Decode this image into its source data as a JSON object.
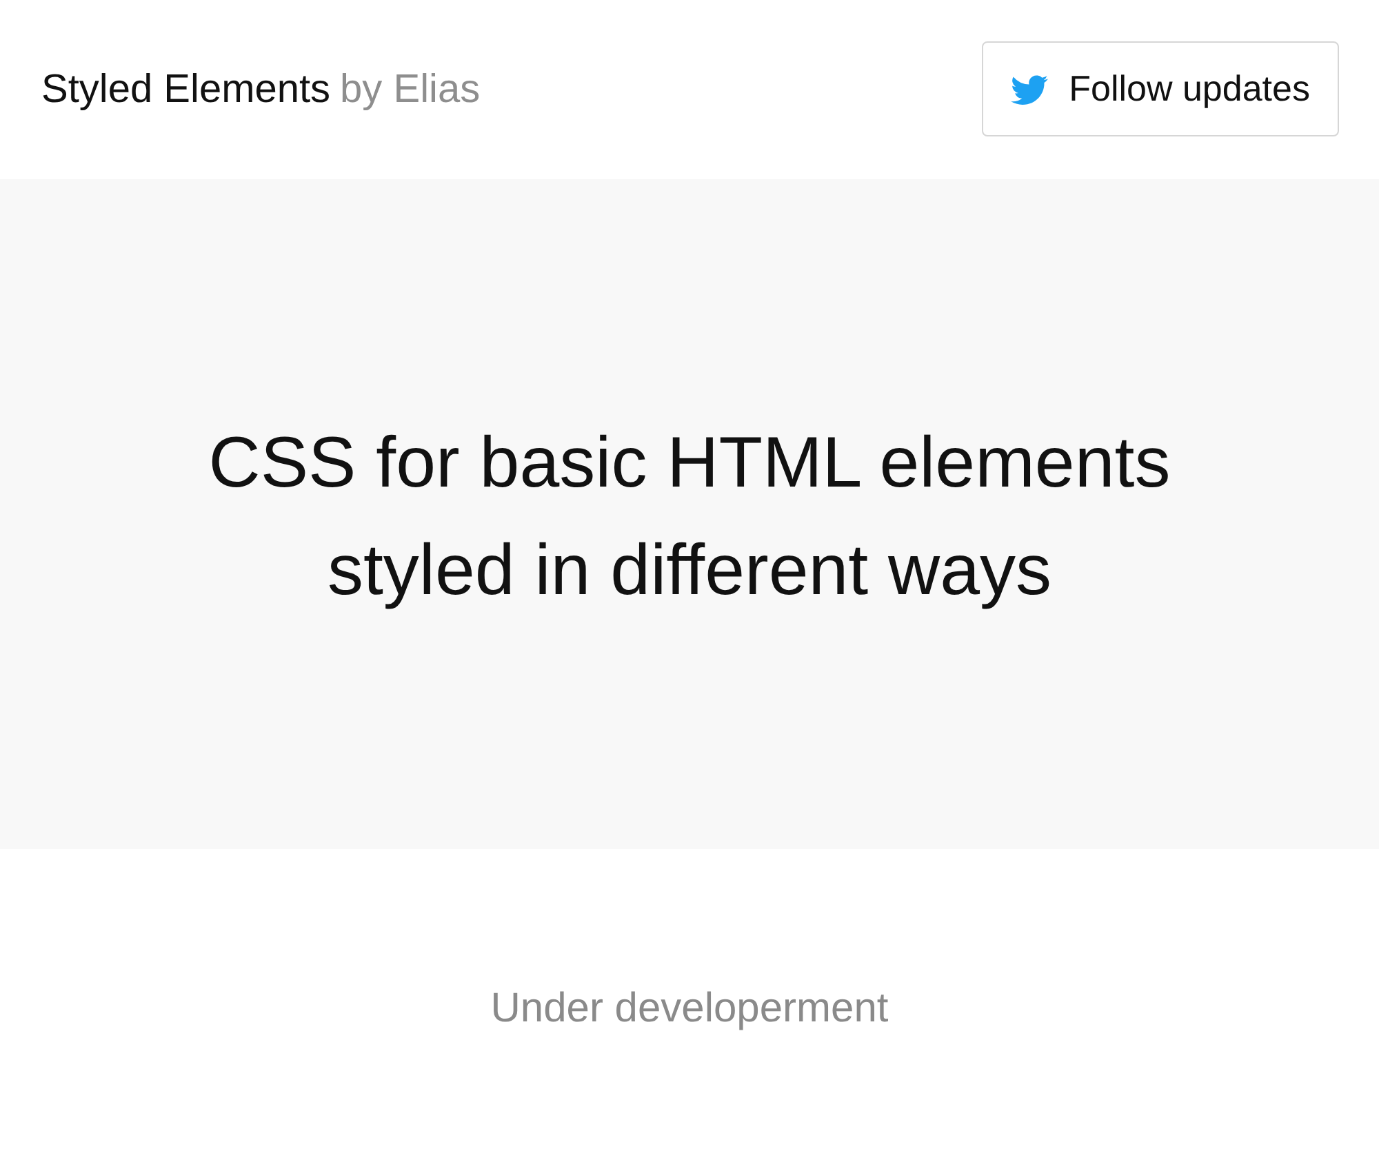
{
  "header": {
    "title": "Styled Elements",
    "byline": "by Elias",
    "follow_button": {
      "label": "Follow updates"
    }
  },
  "hero": {
    "heading": "CSS for basic HTML elements styled in different ways"
  },
  "footer": {
    "note": "Under developerment"
  }
}
